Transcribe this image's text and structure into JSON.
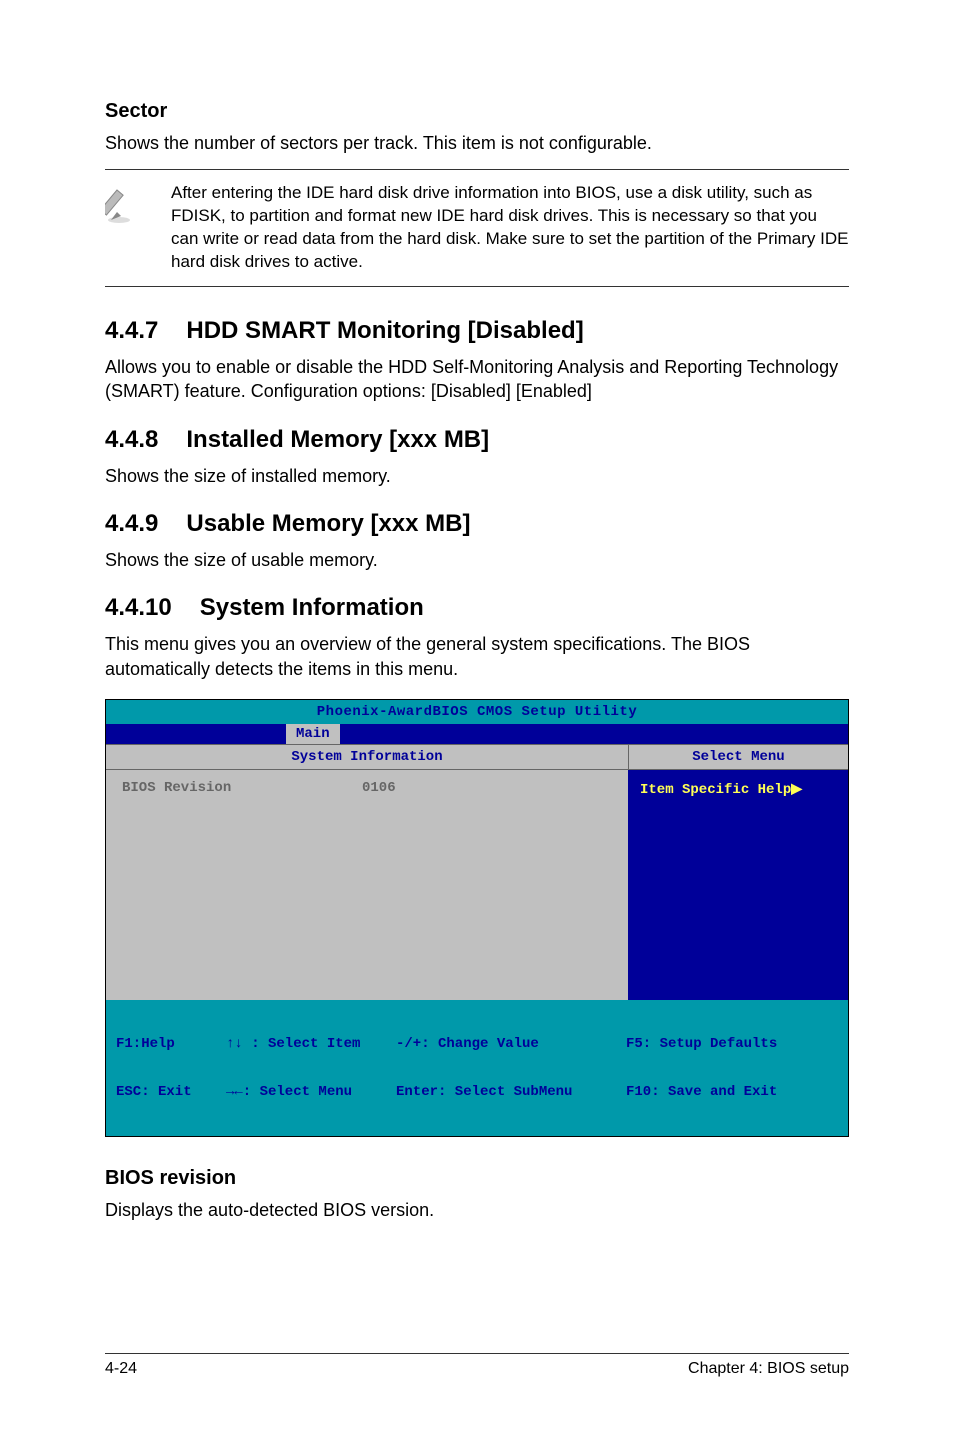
{
  "section1": {
    "title": "Sector",
    "body": "Shows the number of sectors per track. This item is not configurable."
  },
  "note": {
    "text": "After entering the IDE hard disk drive information into BIOS, use a disk utility, such as FDISK, to partition and format new IDE hard disk drives. This is necessary so that you can write or read data from the hard disk. Make sure to set the partition of the Primary IDE hard disk drives to active."
  },
  "sec447": {
    "num": "4.4.7",
    "title": "HDD SMART Monitoring [Disabled]",
    "body": "Allows you to enable or disable the HDD Self-Monitoring Analysis and Reporting Technology (SMART) feature. Configuration options: [Disabled] [Enabled]"
  },
  "sec448": {
    "num": "4.4.8",
    "title": "Installed Memory [xxx MB]",
    "body": "Shows the size of installed memory."
  },
  "sec449": {
    "num": "4.4.9",
    "title": "Usable Memory [xxx MB]",
    "body": "Shows the size of usable memory."
  },
  "sec4410": {
    "num": "4.4.10",
    "title": "System Information",
    "body": "This menu gives you an overview of the general system specifications. The BIOS automatically detects the items in this menu."
  },
  "bios": {
    "title": "Phoenix-AwardBIOS CMOS Setup Utility",
    "tab": "Main",
    "left_header": "System Information",
    "right_header": "Select Menu",
    "row1_key": "BIOS Revision",
    "row1_val": "0106",
    "right_body": "Item Specific Help",
    "footer": {
      "f1": "F1:Help",
      "esc": "ESC: Exit",
      "sel_item": "↑↓ : Select Item",
      "sel_menu": "→←: Select Menu",
      "change": "-/+: Change Value",
      "enter": "Enter: Select SubMenu",
      "f5": "F5: Setup Defaults",
      "f10": "F10: Save and Exit"
    }
  },
  "section_last": {
    "title": "BIOS revision",
    "body": "Displays the auto-detected BIOS version."
  },
  "footer": {
    "left": "4-24",
    "right": "Chapter 4: BIOS setup"
  }
}
